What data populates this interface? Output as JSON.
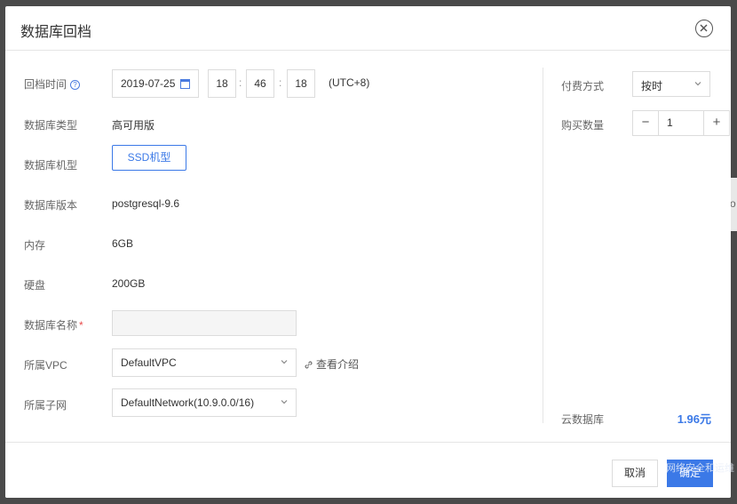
{
  "dialog": {
    "title": "数据库回档"
  },
  "form": {
    "rollback_time": {
      "label": "回档时间",
      "date": "2019-07-25",
      "hour": "18",
      "minute": "46",
      "second": "18",
      "separator": ":",
      "timezone": "(UTC+8)"
    },
    "db_type": {
      "label": "数据库类型",
      "value": "高可用版"
    },
    "db_model": {
      "label": "数据库机型",
      "value": "SSD机型"
    },
    "db_version": {
      "label": "数据库版本",
      "value": "postgresql-9.6"
    },
    "memory": {
      "label": "内存",
      "value": "6GB"
    },
    "disk": {
      "label": "硬盘",
      "value": "200GB"
    },
    "db_name": {
      "label": "数据库名称",
      "required_mark": "*",
      "value": ""
    },
    "vpc": {
      "label": "所属VPC",
      "value": "DefaultVPC",
      "link_label": "查看介绍"
    },
    "subnet": {
      "label": "所属子网",
      "value": "DefaultNetwork(10.9.0.0/16)"
    }
  },
  "billing": {
    "pay_method": {
      "label": "付费方式",
      "value": "按时"
    },
    "quantity": {
      "label": "购买数量",
      "value": "1",
      "minus": "−",
      "plus": "+"
    },
    "price": {
      "label": "云数据库",
      "value": "1.96元"
    }
  },
  "footer": {
    "cancel_label": "取消",
    "ok_label": "确定"
  },
  "background": {
    "edge_text": "o"
  },
  "watermark": {
    "text": "网络安全和运维"
  },
  "colors": {
    "accent": "#3b79e7",
    "required": "#e84a4a"
  }
}
